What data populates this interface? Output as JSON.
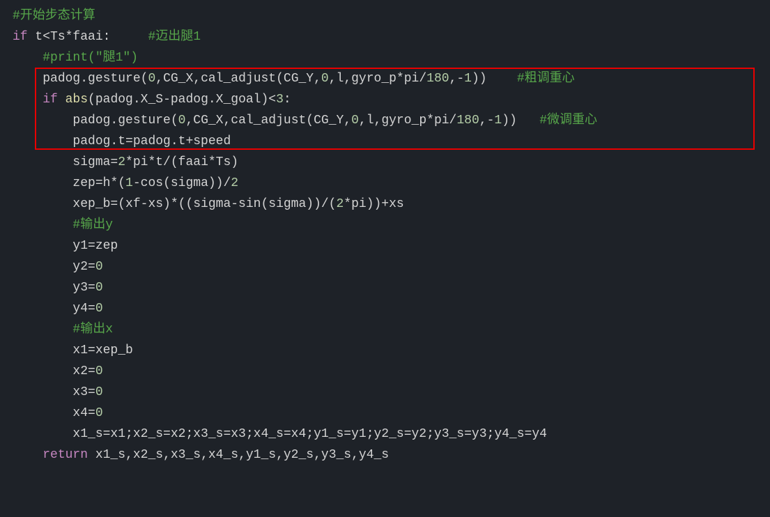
{
  "code": {
    "l1_comment": "#开始步态计算",
    "l2_if": "if",
    "l2_cond": " t<Ts*faai:",
    "l2_comment": "#迈出腿1",
    "l3_comment": "#print(\"腿1\")",
    "l4_code": "padog.gesture(",
    "l4_num0": "0",
    "l4_p1": ",CG_X,cal_adjust(CG_Y,",
    "l4_num1": "0",
    "l4_p2": ",l,gyro_p*pi/",
    "l4_num180": "180",
    "l4_p3": ",-",
    "l4_num1b": "1",
    "l4_p4": "))",
    "l4_comment": "#粗调重心",
    "l5_if": "if",
    "l5_abs": " abs",
    "l5_cond": "(padog.X_S-padog.X_goal)<",
    "l5_num3": "3",
    "l5_colon": ":",
    "l6_code": "padog.gesture(",
    "l6_comment": "#微调重心",
    "l7": "padog.t=padog.t+speed",
    "l8_p1": "sigma=",
    "l8_num2": "2",
    "l8_p2": "*pi*t/(faai*Ts)",
    "l9_p1": "zep=h*(",
    "l9_num1": "1",
    "l9_p2": "-cos(sigma))/",
    "l9_num2": "2",
    "l10_p1": "xep_b=(xf-xs)*((sigma-sin(sigma))/(",
    "l10_num2": "2",
    "l10_p2": "*pi))+xs",
    "l11_comment": "#输出y",
    "l12": "y1=zep",
    "l13": "y2=",
    "l13_num": "0",
    "l14": "y3=",
    "l14_num": "0",
    "l15": "y4=",
    "l15_num": "0",
    "l16_comment": "#输出x",
    "l17": "x1=xep_b",
    "l18": "x2=",
    "l18_num": "0",
    "l19": "x3=",
    "l19_num": "0",
    "l20": "x4=",
    "l20_num": "0",
    "l21": "x1_s=x1;x2_s=x2;x3_s=x3;x4_s=x4;y1_s=y1;y2_s=y2;y3_s=y3;y4_s=y4",
    "l22_return": "return",
    "l22_vals": " x1_s,x2_s,x3_s,x4_s,y1_s,y2_s,y3_s,y4_s"
  }
}
